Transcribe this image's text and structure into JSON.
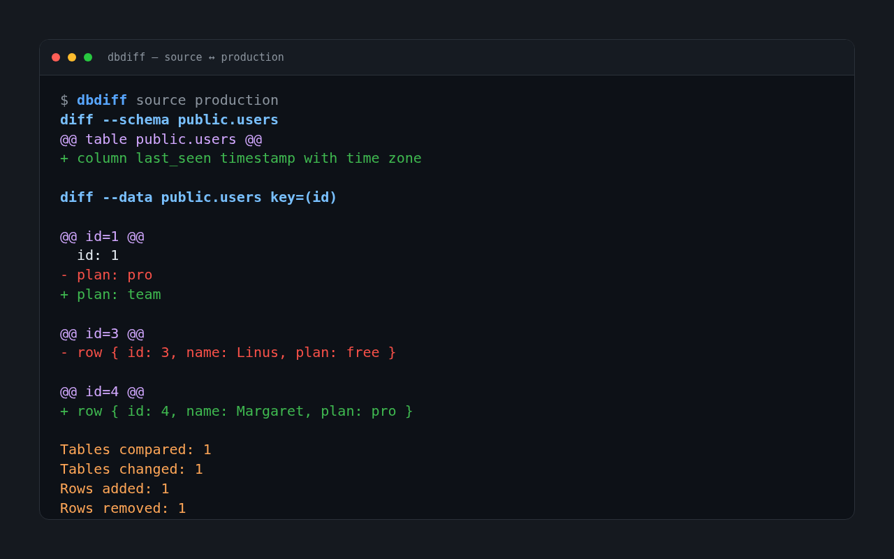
{
  "window": {
    "title": "dbdiff — source ↔ production"
  },
  "terminal": {
    "blocks": [
      {
        "lines": [
          {
            "kind": "prompt",
            "symbol": "$",
            "command": "dbdiff",
            "args": "source production"
          },
          {
            "kind": "header",
            "text": "diff --schema public.users"
          },
          {
            "kind": "hunk",
            "text": "@@ table public.users @@"
          },
          {
            "kind": "add",
            "text": "+ column last_seen timestamp with time zone"
          }
        ]
      },
      {
        "lines": [
          {
            "kind": "header",
            "text": "diff --data public.users key=(id)"
          }
        ]
      },
      {
        "lines": [
          {
            "kind": "hunk",
            "text": "@@ id=1 @@"
          },
          {
            "kind": "context",
            "text": "id: 1"
          },
          {
            "kind": "del",
            "text": "- plan: pro"
          },
          {
            "kind": "add",
            "text": "+ plan: team"
          }
        ]
      },
      {
        "lines": [
          {
            "kind": "hunk",
            "text": "@@ id=3 @@"
          },
          {
            "kind": "del",
            "text": "- row { id: 3, name: Linus, plan: free }"
          }
        ]
      },
      {
        "lines": [
          {
            "kind": "hunk",
            "text": "@@ id=4 @@"
          },
          {
            "kind": "add",
            "text": "+ row { id: 4, name: Margaret, plan: pro }"
          }
        ]
      },
      {
        "lines": [
          {
            "kind": "summary",
            "text": "Tables compared: 1"
          },
          {
            "kind": "summary",
            "text": "Tables changed: 1"
          },
          {
            "kind": "summary",
            "text": "Rows added: 1"
          },
          {
            "kind": "summary",
            "text": "Rows removed: 1"
          }
        ]
      }
    ]
  }
}
